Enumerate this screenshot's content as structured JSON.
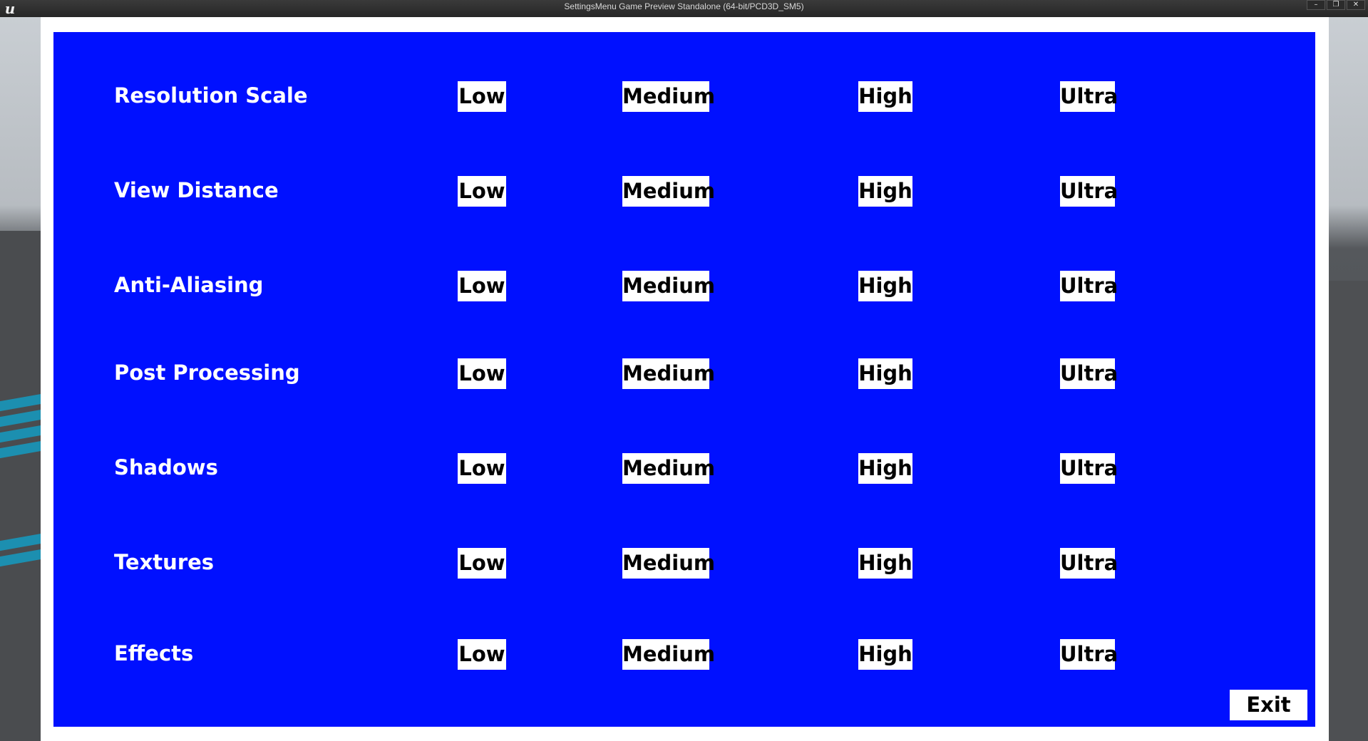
{
  "window": {
    "title": "SettingsMenu Game Preview Standalone (64-bit/PCD3D_SM5)",
    "logo_icon": "unreal-engine-logo-icon",
    "controls": {
      "minimize_icon": "minimize-icon",
      "restore_icon": "restore-icon",
      "close_icon": "close-icon"
    }
  },
  "settings": {
    "options": [
      "Low",
      "Medium",
      "High",
      "Ultra"
    ],
    "rows": [
      {
        "label": "Resolution Scale",
        "options": [
          "Low",
          "Medium",
          "High",
          "Ultra"
        ]
      },
      {
        "label": "View Distance",
        "options": [
          "Low",
          "Medium",
          "High",
          "Ultra"
        ]
      },
      {
        "label": "Anti-Aliasing",
        "options": [
          "Low",
          "Medium",
          "High",
          "Ultra"
        ]
      },
      {
        "label": "Post Processing",
        "options": [
          "Low",
          "Medium",
          "High",
          "Ultra"
        ]
      },
      {
        "label": "Shadows",
        "options": [
          "Low",
          "Medium",
          "High",
          "Ultra"
        ]
      },
      {
        "label": "Textures",
        "options": [
          "Low",
          "Medium",
          "High",
          "Ultra"
        ]
      },
      {
        "label": "Effects",
        "options": [
          "Low",
          "Medium",
          "High",
          "Ultra"
        ]
      }
    ]
  },
  "exit_label": "Exit",
  "colors": {
    "panel_background": "#0010ff",
    "button_background": "#ffffff",
    "button_text": "#000000",
    "label_text": "#ffffff"
  }
}
